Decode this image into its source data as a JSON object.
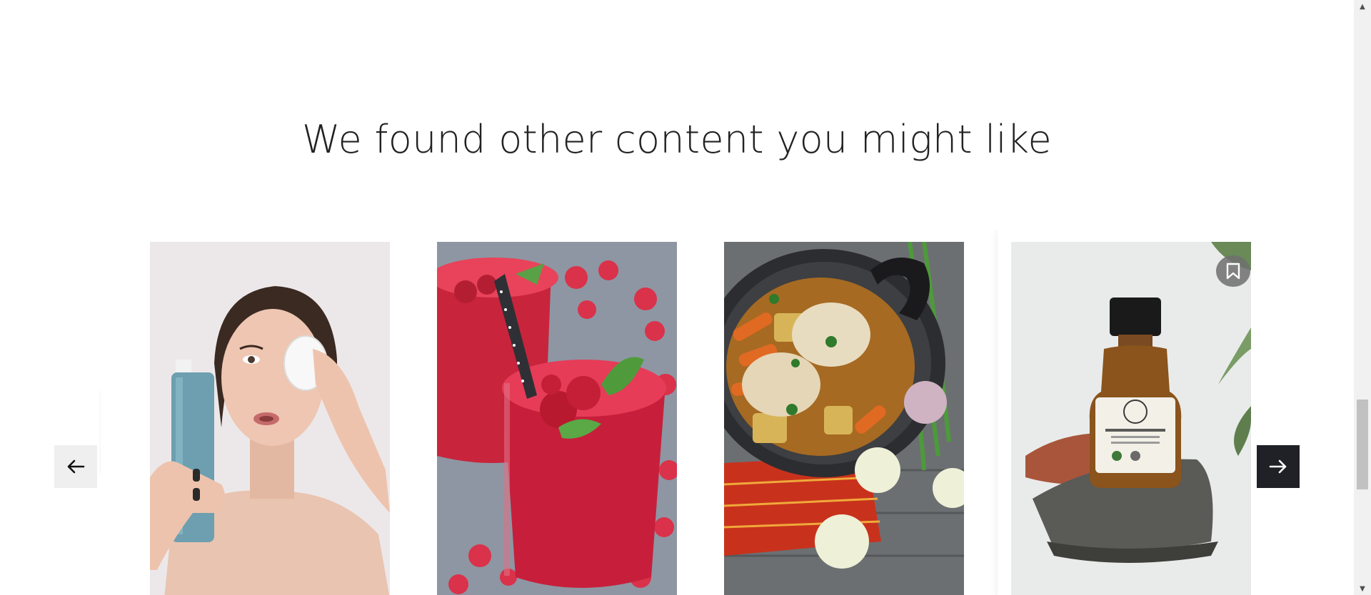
{
  "section": {
    "heading": "We found other content you might like"
  },
  "carousel": {
    "items": [
      {
        "image": "woman-removing-makeup-with-toner"
      },
      {
        "image": "raspberry-smoothie-glasses"
      },
      {
        "image": "chicken-soup-pot-with-vegetables"
      },
      {
        "image": "amber-oil-bottle-on-stone"
      }
    ],
    "bookmark_icon": "bookmark-icon",
    "prev_icon": "arrow-left-icon",
    "next_icon": "arrow-right-icon"
  },
  "colors": {
    "next_button": "#1f2126",
    "prev_button": "#efefef",
    "bookmark_bg": "#6e6e6e",
    "heading_text": "#222222"
  }
}
